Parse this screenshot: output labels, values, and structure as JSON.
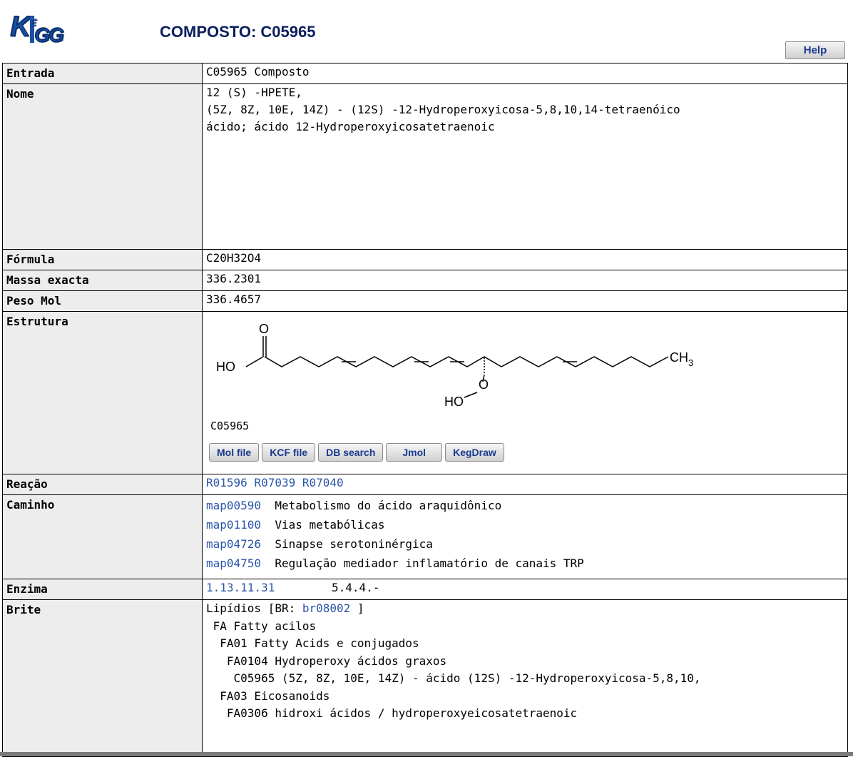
{
  "header": {
    "logo": "KEGG",
    "title": "COMPOSTO: C05965",
    "help_label": "Help"
  },
  "rows": {
    "entry": {
      "label": "Entrada",
      "value": "C05965 Composto"
    },
    "name": {
      "label": "Nome",
      "lines": [
        "12 (S) -HPETE,",
        "(5Z, 8Z, 10E, 14Z) - (12S) -12-Hydroperoxyicosa-5,8,10,14-tetraenóico",
        "ácido; ácido 12-Hydroperoxyicosatetraenoic"
      ]
    },
    "formula": {
      "label": "Fórmula",
      "value": "C20H32O4"
    },
    "exact_mass": {
      "label": "Massa exacta",
      "value": "336.2301"
    },
    "mol_weight": {
      "label": "Peso Mol",
      "value": "336.4657"
    },
    "structure": {
      "label": "Estrutura",
      "caption": "C05965",
      "atoms": {
        "o_top": "O",
        "ho": "HO",
        "ch3": "CH",
        "ch3_sub": "3",
        "o_mid": "O",
        "ho2": "HO"
      },
      "buttons": [
        "Mol file",
        "KCF file",
        "DB search",
        "Jmol",
        "KegDraw"
      ]
    },
    "reaction": {
      "label": "Reação",
      "links": [
        "R01596",
        "R07039",
        "R07040"
      ]
    },
    "pathway": {
      "label": "Caminho",
      "items": [
        {
          "id": "map00590",
          "name": "Metabolismo do ácido araquidônico"
        },
        {
          "id": "map01100",
          "name": "Vias metabólicas"
        },
        {
          "id": "map04726",
          "name": "Sinapse serotoninérgica"
        },
        {
          "id": "map04750",
          "name": "Regulação mediador inflamatório de canais TRP"
        }
      ]
    },
    "enzyme": {
      "label": "Enzima",
      "links": [
        "1.13.11.31",
        "5.4.4.-"
      ]
    },
    "brite": {
      "label": "Brite",
      "line0_prefix": "Lipídios [BR: ",
      "line0_link": "br08002",
      "line0_suffix": " ]",
      "lines": [
        " FA Fatty acilos",
        "  FA01 Fatty Acids e conjugados",
        "   FA0104 Hydroperoxy ácidos graxos",
        "    C05965 (5Z, 8Z, 10E, 14Z) - ácido (12S) -12-Hydroperoxyicosa-5,8,10,",
        "  FA03 Eicosanoids",
        "   FA0306 hidroxi ácidos / hydroperoxyeicosatetraenoic"
      ]
    }
  }
}
